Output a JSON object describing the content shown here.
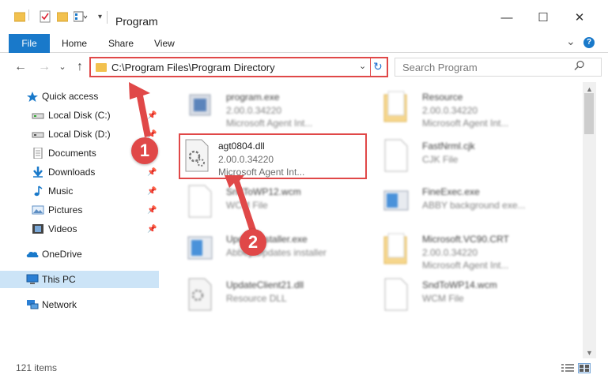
{
  "window": {
    "title": "Program",
    "controls": {
      "minimize": "—",
      "maximize": "☐",
      "close": "✕"
    }
  },
  "ribbon": {
    "tabs": [
      {
        "label": "File",
        "active": true
      },
      {
        "label": "Home"
      },
      {
        "label": "Share"
      },
      {
        "label": "View"
      }
    ],
    "expand_glyph": "⌄",
    "help_glyph": "?"
  },
  "address_bar": {
    "path": "C:\\Program Files\\Program Directory",
    "dropdown_glyph": "⌄",
    "refresh_glyph": "↻"
  },
  "search": {
    "placeholder": "Search Program",
    "icon": "search-icon"
  },
  "nav": {
    "back_glyph": "←",
    "forward_glyph": "→",
    "recent_glyph": "⌄",
    "up_glyph": "↑"
  },
  "sidebar": {
    "items": [
      {
        "label": "Quick access",
        "icon": "star-icon",
        "pinned": false
      },
      {
        "label": "Local Disk (C:)",
        "icon": "drive-icon",
        "pinned": true
      },
      {
        "label": "Local Disk (D:)",
        "icon": "drive-icon",
        "pinned": true
      },
      {
        "label": "Documents",
        "icon": "documents-icon",
        "pinned": true
      },
      {
        "label": "Downloads",
        "icon": "downloads-icon",
        "pinned": true
      },
      {
        "label": "Music",
        "icon": "music-icon",
        "pinned": true
      },
      {
        "label": "Pictures",
        "icon": "pictures-icon",
        "pinned": true
      },
      {
        "label": "Videos",
        "icon": "videos-icon",
        "pinned": true
      },
      {
        "label": "OneDrive",
        "icon": "cloud-icon",
        "pinned": false
      },
      {
        "label": "This PC",
        "icon": "pc-icon",
        "pinned": false,
        "selected": true
      },
      {
        "label": "Network",
        "icon": "network-icon",
        "pinned": false
      }
    ],
    "pin_glyph": "📌"
  },
  "files": [
    {
      "name": "program.exe",
      "line2": "2.00.0.34220",
      "line3": "Microsoft Agent Int...",
      "icon": "exe-icon",
      "highlighted": false
    },
    {
      "name": "Resource",
      "line2": "2.00.0.34220",
      "line3": "Microsoft Agent Int...",
      "icon": "folder-icon",
      "highlighted": false
    },
    {
      "name": "agt0804.dll",
      "line2": "2.00.0.34220",
      "line3": "Microsoft Agent Int...",
      "icon": "dll-icon",
      "highlighted": true
    },
    {
      "name": "FastNrml.cjk",
      "line2": "CJK File",
      "line3": "",
      "icon": "file-icon",
      "highlighted": false
    },
    {
      "name": "SndToWP12.wcm",
      "line2": "WCM File",
      "line3": "",
      "icon": "file-icon",
      "highlighted": false
    },
    {
      "name": "FineExec.exe",
      "line2": "ABBY background exe...",
      "line3": "",
      "icon": "exe-icon",
      "highlighted": false
    },
    {
      "name": "UpdateInstaller.exe",
      "line2": "Abbey Updates installer",
      "line3": "",
      "icon": "installer-icon",
      "highlighted": false
    },
    {
      "name": "Microsoft.VC90.CRT",
      "line2": "2.00.0.34220",
      "line3": "Microsoft Agent Int...",
      "icon": "folder-icon",
      "highlighted": false
    },
    {
      "name": "UpdateClient21.dll",
      "line2": "Resource DLL",
      "line3": "",
      "icon": "dll-icon",
      "highlighted": false
    },
    {
      "name": "SndToWP14.wcm",
      "line2": "WCM File",
      "line3": "",
      "icon": "file-icon",
      "highlighted": false
    }
  ],
  "status": {
    "item_count": "121 items"
  },
  "callouts": [
    "1",
    "2"
  ],
  "colors": {
    "accent": "#1979ca",
    "highlight_red": "#e04848",
    "selection": "#cce4f7"
  }
}
